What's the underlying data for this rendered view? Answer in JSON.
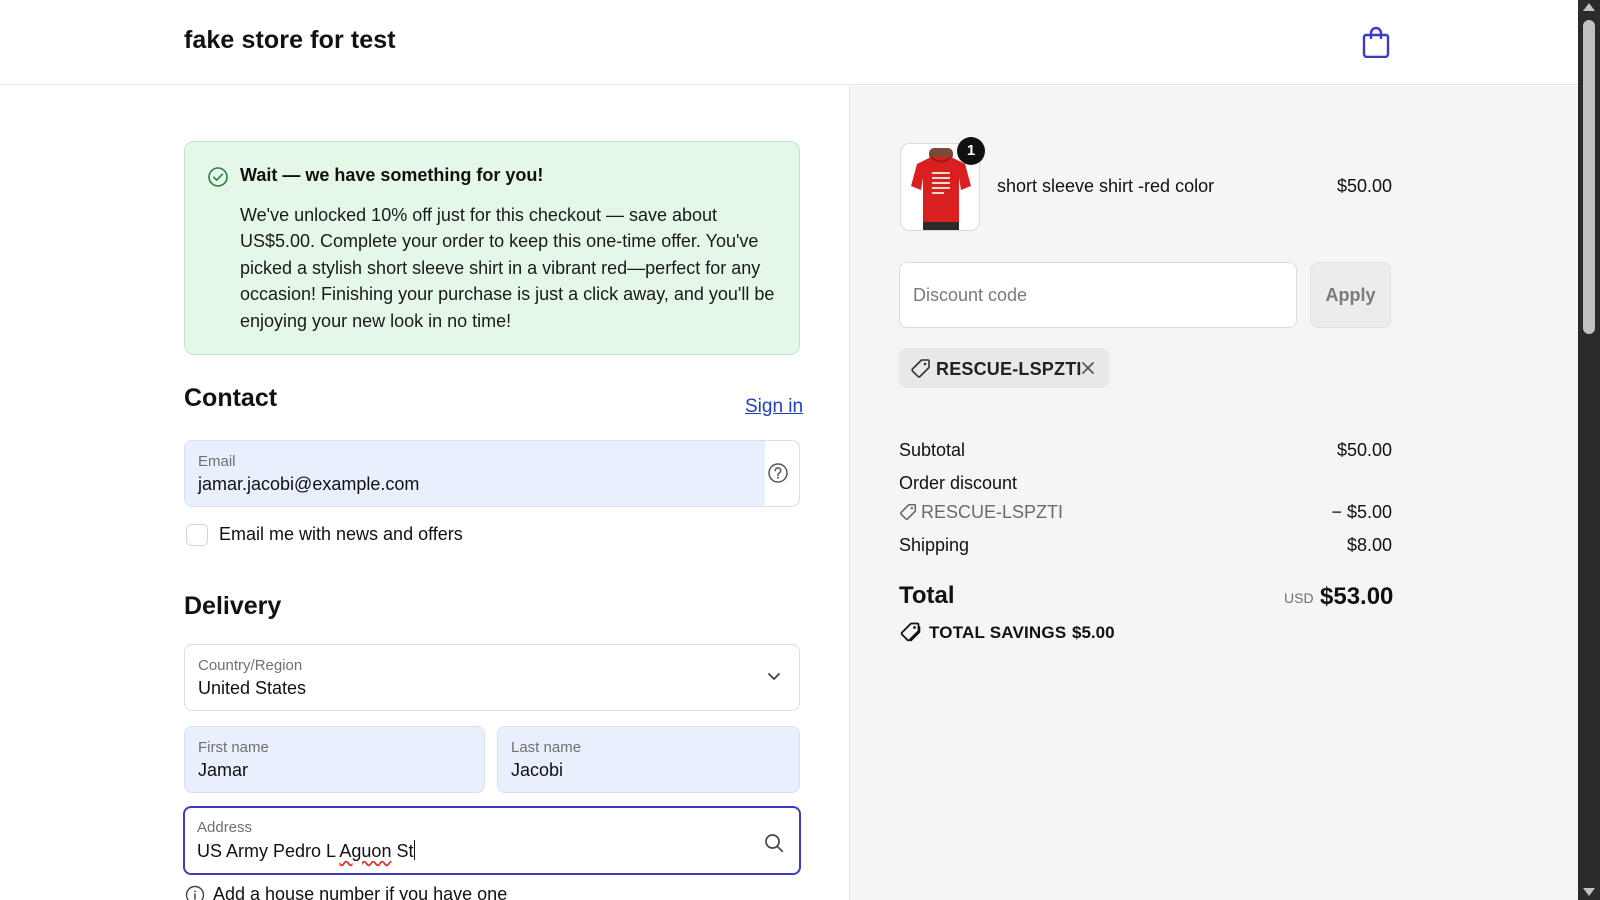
{
  "header": {
    "store_name": "fake store for test",
    "cart_icon": "shopping-bag-icon"
  },
  "offer": {
    "icon": "check-circle-icon",
    "title": "Wait — we have something for you!",
    "text": "We've unlocked 10% off just for this checkout — save about US$5.00. Complete your order to keep this one-time offer. You've picked a stylish short sleeve shirt in a vibrant red—perfect for any occasion! Finishing your purchase is just a click away, and you'll be enjoying your new look in no time!"
  },
  "contact": {
    "title": "Contact",
    "signin_label": "Sign in",
    "email": {
      "label": "Email",
      "value": "jamar.jacobi@example.com",
      "help_icon": "question-circle-icon"
    },
    "newsletter": {
      "label": "Email me with news and offers",
      "checked": false
    }
  },
  "delivery": {
    "title": "Delivery",
    "country": {
      "label": "Country/Region",
      "value": "United States",
      "icon": "chevron-down-icon"
    },
    "first_name": {
      "label": "First name",
      "value": "Jamar"
    },
    "last_name": {
      "label": "Last name",
      "value": "Jacobi"
    },
    "address": {
      "label": "Address",
      "value_plain": "US Army Pedro L ",
      "value_misspelled": "Aguon",
      "value_tail": " St",
      "icon": "search-icon"
    },
    "hint": {
      "icon": "info-circle-icon",
      "text": "Add a house number if you have one"
    }
  },
  "summary": {
    "product": {
      "name": "short sleeve shirt -red color",
      "price": "$50.00",
      "quantity": "1",
      "image": "red-shirt-thumbnail"
    },
    "discount": {
      "placeholder": "Discount code",
      "apply_label": "Apply",
      "applied_code": "RESCUE-LSPZTI",
      "tag_icon": "tag-icon",
      "remove_icon": "close-icon"
    },
    "lines": {
      "subtotal_label": "Subtotal",
      "subtotal_value": "$50.00",
      "order_discount_label": "Order discount",
      "order_discount_code": "RESCUE-LSPZTI",
      "order_discount_value": "− $5.00",
      "shipping_label": "Shipping",
      "shipping_value": "$8.00"
    },
    "total": {
      "label": "Total",
      "currency": "USD",
      "value": "$53.00",
      "savings_label": "TOTAL SAVINGS",
      "savings_value": "$5.00",
      "savings_icon": "tags-icon"
    }
  },
  "colors": {
    "accent": "#3d3bc4",
    "link": "#1f3fbf",
    "offer_bg": "#e5f8e8",
    "filled_field_bg": "#e8effd",
    "summary_bg": "#f5f5f5",
    "product_red": "#d9201f"
  }
}
